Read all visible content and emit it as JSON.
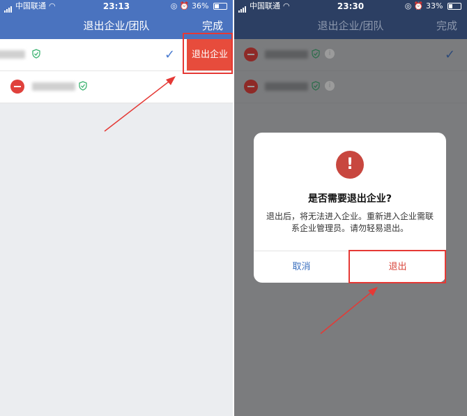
{
  "left": {
    "status": {
      "carrier": "中国联通",
      "time": "23:13",
      "battery": "36%",
      "battery_level": 0.36
    },
    "nav": {
      "title": "退出企业/团队",
      "done": "完成"
    },
    "exit_button": "退出企业"
  },
  "right": {
    "status": {
      "carrier": "中国联通",
      "time": "23:30",
      "battery": "33%",
      "battery_level": 0.33
    },
    "nav": {
      "title": "退出企业/团队",
      "done": "完成"
    },
    "dialog": {
      "icon": "!",
      "title": "是否需要退出企业?",
      "message": "退出后，将无法进入企业。重新进入企业需联系企业管理员。请勿轻易退出。",
      "cancel": "取消",
      "confirm": "退出"
    }
  },
  "colors": {
    "accent": "#4a73bf",
    "danger": "#e74c3c",
    "highlight": "#e53935"
  }
}
